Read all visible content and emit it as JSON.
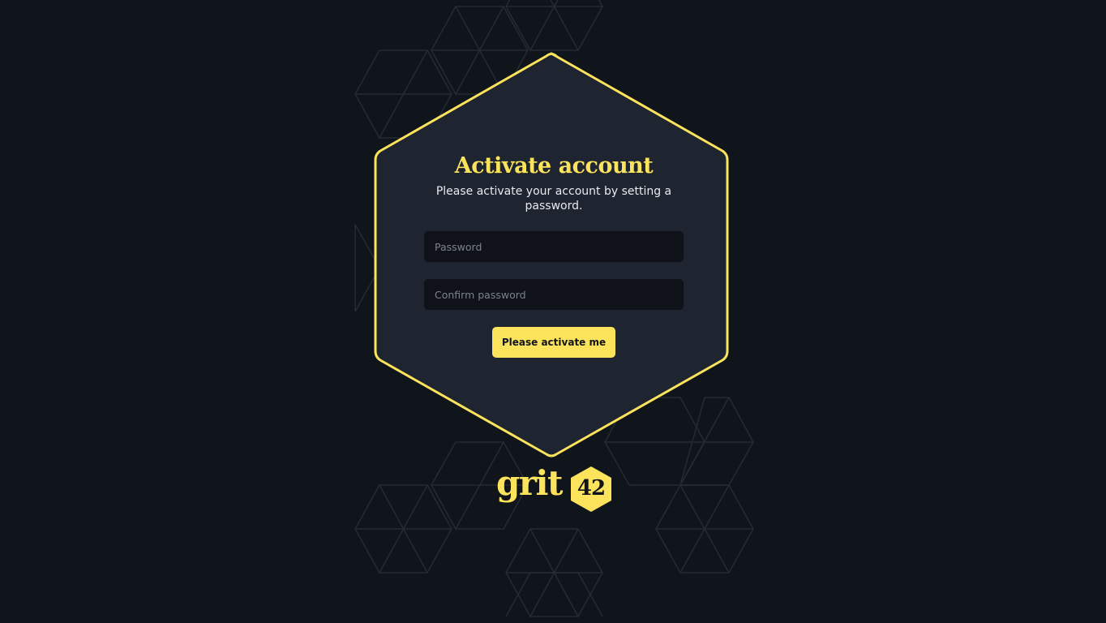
{
  "card": {
    "title": "Activate account",
    "subtitle": "Please activate your account by setting a password."
  },
  "form": {
    "password_placeholder": "Password",
    "password_value": "",
    "confirm_placeholder": "Confirm password",
    "confirm_value": "",
    "submit_label": "Please activate me"
  },
  "logo": {
    "word": "grit",
    "number": "42"
  },
  "colors": {
    "background": "#10141b",
    "card": "#1e2430",
    "accent": "#fbe35c",
    "input": "#0f1218",
    "pattern_stroke": "#262b33"
  }
}
